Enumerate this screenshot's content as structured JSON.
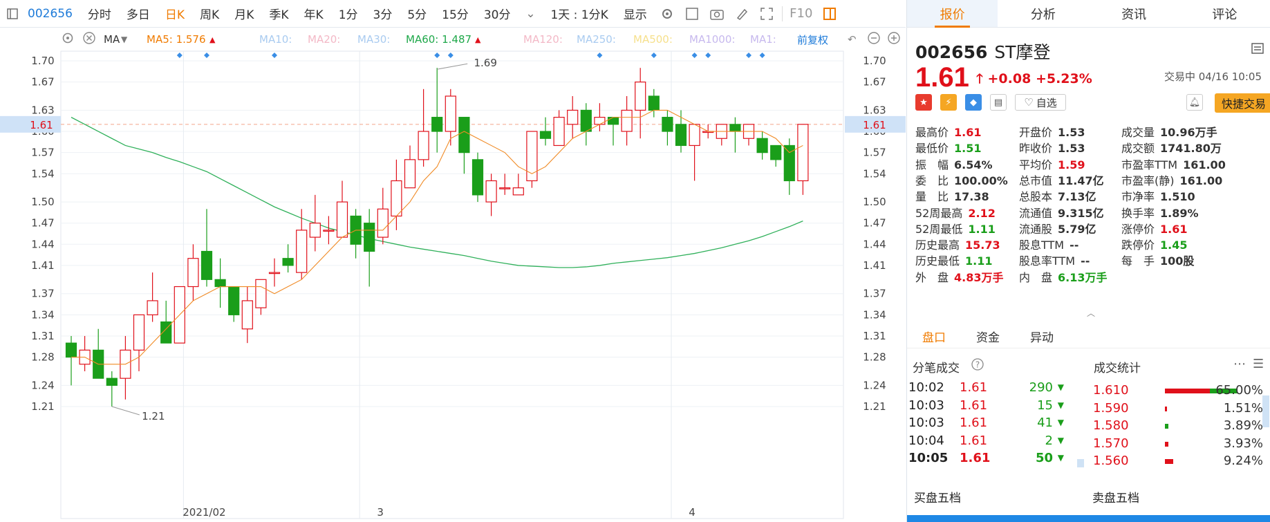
{
  "toolbar": {
    "code": "002656",
    "items": [
      "分时",
      "多日",
      "日K",
      "周K",
      "月K",
      "季K",
      "年K",
      "1分",
      "3分",
      "5分",
      "15分",
      "30分"
    ],
    "active_index": 2,
    "period_select": "1天 : 1分K",
    "display_label": "显示"
  },
  "ma_bar": {
    "ma_label": "MA",
    "ma5": "MA5: 1.576",
    "ma10": "MA10:",
    "ma20": "MA20:",
    "ma30": "MA30:",
    "ma60": "MA60: 1.487",
    "ma120": "MA120:",
    "ma250": "MA250:",
    "ma500": "MA500:",
    "ma1000": "MA1000:",
    "ma1": "MA1:",
    "adjust_label": "前复权",
    "colors": {
      "ma5": "#f07b00",
      "ma60": "#1fa84a",
      "faded_blue": "#a9cbf0",
      "faded_pink": "#f3b8c6",
      "faded_yellow": "#f6e08c",
      "faded_purple": "#c7b9ee"
    }
  },
  "chart_data": {
    "type": "candlestick",
    "y_ticks": [
      "1.70",
      "1.67",
      "1.63",
      "1.60",
      "1.57",
      "1.54",
      "1.50",
      "1.47",
      "1.44",
      "1.41",
      "1.37",
      "1.34",
      "1.31",
      "1.28",
      "1.24",
      "1.21"
    ],
    "ylim": [
      1.195,
      1.715
    ],
    "current_price": "1.61",
    "high_label": "1.69",
    "low_label": "1.21",
    "x_labels": [
      {
        "i": 9,
        "label": "2021/02"
      },
      {
        "i": 22,
        "label": "3"
      },
      {
        "i": 45,
        "label": "4"
      }
    ],
    "candles": [
      [
        1.3,
        1.28,
        1.31,
        1.24
      ],
      [
        1.27,
        1.29,
        1.31,
        1.26
      ],
      [
        1.29,
        1.25,
        1.32,
        1.25
      ],
      [
        1.25,
        1.24,
        1.26,
        1.21
      ],
      [
        1.25,
        1.29,
        1.31,
        1.22
      ],
      [
        1.29,
        1.34,
        1.34,
        1.26
      ],
      [
        1.34,
        1.36,
        1.4,
        1.33
      ],
      [
        1.33,
        1.3,
        1.36,
        1.3
      ],
      [
        1.3,
        1.38,
        1.38,
        1.3
      ],
      [
        1.38,
        1.42,
        1.44,
        1.36
      ],
      [
        1.43,
        1.39,
        1.49,
        1.38
      ],
      [
        1.39,
        1.38,
        1.42,
        1.35
      ],
      [
        1.38,
        1.34,
        1.38,
        1.33
      ],
      [
        1.32,
        1.36,
        1.38,
        1.3
      ],
      [
        1.35,
        1.39,
        1.39,
        1.34
      ],
      [
        1.4,
        1.4,
        1.42,
        1.38
      ],
      [
        1.42,
        1.41,
        1.44,
        1.4
      ],
      [
        1.4,
        1.46,
        1.49,
        1.39
      ],
      [
        1.45,
        1.47,
        1.51,
        1.43
      ],
      [
        1.46,
        1.46,
        1.48,
        1.44
      ],
      [
        1.45,
        1.5,
        1.53,
        1.45
      ],
      [
        1.48,
        1.44,
        1.49,
        1.42
      ],
      [
        1.47,
        1.43,
        1.49,
        1.38
      ],
      [
        1.45,
        1.49,
        1.52,
        1.44
      ],
      [
        1.48,
        1.53,
        1.56,
        1.46
      ],
      [
        1.52,
        1.56,
        1.58,
        1.52
      ],
      [
        1.56,
        1.6,
        1.66,
        1.55
      ],
      [
        1.62,
        1.6,
        1.69,
        1.57
      ],
      [
        1.6,
        1.65,
        1.66,
        1.58
      ],
      [
        1.62,
        1.57,
        1.62,
        1.54
      ],
      [
        1.56,
        1.51,
        1.57,
        1.5
      ],
      [
        1.5,
        1.53,
        1.54,
        1.48
      ],
      [
        1.52,
        1.52,
        1.54,
        1.51
      ],
      [
        1.51,
        1.52,
        1.54,
        1.51
      ],
      [
        1.53,
        1.6,
        1.6,
        1.52
      ],
      [
        1.6,
        1.59,
        1.62,
        1.58
      ],
      [
        1.58,
        1.62,
        1.63,
        1.58
      ],
      [
        1.61,
        1.63,
        1.65,
        1.59
      ],
      [
        1.63,
        1.6,
        1.64,
        1.58
      ],
      [
        1.61,
        1.62,
        1.64,
        1.6
      ],
      [
        1.62,
        1.61,
        1.62,
        1.58
      ],
      [
        1.6,
        1.63,
        1.65,
        1.58
      ],
      [
        1.63,
        1.67,
        1.69,
        1.59
      ],
      [
        1.65,
        1.63,
        1.66,
        1.62
      ],
      [
        1.62,
        1.6,
        1.63,
        1.58
      ],
      [
        1.61,
        1.58,
        1.63,
        1.57
      ],
      [
        1.58,
        1.61,
        1.61,
        1.53
      ],
      [
        1.6,
        1.6,
        1.61,
        1.59
      ],
      [
        1.59,
        1.61,
        1.61,
        1.58
      ],
      [
        1.61,
        1.6,
        1.62,
        1.57
      ],
      [
        1.59,
        1.61,
        1.61,
        1.58
      ],
      [
        1.59,
        1.57,
        1.6,
        1.56
      ],
      [
        1.58,
        1.56,
        1.58,
        1.55
      ],
      [
        1.58,
        1.53,
        1.59,
        1.51
      ],
      [
        1.53,
        1.61,
        1.61,
        1.51
      ]
    ],
    "ma5": [
      1.28,
      1.28,
      1.27,
      1.27,
      1.27,
      1.28,
      1.3,
      1.32,
      1.34,
      1.36,
      1.37,
      1.38,
      1.38,
      1.38,
      1.38,
      1.37,
      1.38,
      1.39,
      1.41,
      1.43,
      1.45,
      1.46,
      1.46,
      1.46,
      1.48,
      1.5,
      1.53,
      1.55,
      1.59,
      1.6,
      1.59,
      1.58,
      1.57,
      1.55,
      1.54,
      1.55,
      1.57,
      1.59,
      1.6,
      1.61,
      1.62,
      1.62,
      1.62,
      1.63,
      1.63,
      1.62,
      1.61,
      1.6,
      1.6,
      1.6,
      1.6,
      1.6,
      1.59,
      1.57,
      1.58
    ],
    "ma60": [
      1.62,
      1.61,
      1.6,
      1.59,
      1.58,
      1.575,
      1.57,
      1.563,
      1.557,
      1.55,
      1.543,
      1.533,
      1.523,
      1.513,
      1.503,
      1.493,
      1.485,
      1.477,
      1.47,
      1.463,
      1.458,
      1.453,
      1.448,
      1.444,
      1.44,
      1.436,
      1.433,
      1.43,
      1.427,
      1.424,
      1.42,
      1.416,
      1.413,
      1.41,
      1.409,
      1.408,
      1.407,
      1.407,
      1.408,
      1.41,
      1.413,
      1.415,
      1.417,
      1.419,
      1.421,
      1.424,
      1.427,
      1.431,
      1.435,
      1.44,
      1.445,
      1.451,
      1.458,
      1.465,
      1.473
    ]
  },
  "panel": {
    "tabs": [
      "报价",
      "分析",
      "资讯",
      "评论"
    ],
    "code": "002656",
    "name": "ST摩登",
    "price": "1.61",
    "change": "+0.08",
    "change_pct": "+5.23%",
    "trade_time": "交易中 04/16 10:05",
    "watch_label": "自选",
    "quick_trade_label": "快捷交易",
    "quotes": [
      {
        "label": "最高价",
        "value": "1.61",
        "cls": "up"
      },
      {
        "label": "开盘价",
        "value": "1.53",
        "cls": "nt"
      },
      {
        "label": "成交量",
        "value": "10.96万手",
        "cls": "nt"
      },
      {
        "label": "最低价",
        "value": "1.51",
        "cls": "dn"
      },
      {
        "label": "昨收价",
        "value": "1.53",
        "cls": "nt"
      },
      {
        "label": "成交额",
        "value": "1741.80万",
        "cls": "nt"
      },
      {
        "label": "振　幅",
        "value": "6.54%",
        "cls": "nt"
      },
      {
        "label": "平均价",
        "value": "1.59",
        "cls": "up"
      },
      {
        "label": "市盈率TTM",
        "value": "161.00",
        "cls": "nt"
      },
      {
        "label": "委　比",
        "value": "100.00%",
        "cls": "nt"
      },
      {
        "label": "总市值",
        "value": "11.47亿",
        "cls": "nt"
      },
      {
        "label": "市盈率(静)",
        "value": "161.00",
        "cls": "nt"
      },
      {
        "label": "量　比",
        "value": "17.38",
        "cls": "nt"
      },
      {
        "label": "总股本",
        "value": "7.13亿",
        "cls": "nt"
      },
      {
        "label": "市净率",
        "value": "1.510",
        "cls": "nt"
      },
      {
        "label": "52周最高",
        "value": "2.12",
        "cls": "up"
      },
      {
        "label": "流通值",
        "value": "9.315亿",
        "cls": "nt"
      },
      {
        "label": "换手率",
        "value": "1.89%",
        "cls": "nt"
      },
      {
        "label": "52周最低",
        "value": "1.11",
        "cls": "dn"
      },
      {
        "label": "流通股",
        "value": "5.79亿",
        "cls": "nt"
      },
      {
        "label": "涨停价",
        "value": "1.61",
        "cls": "up"
      },
      {
        "label": "历史最高",
        "value": "15.73",
        "cls": "up"
      },
      {
        "label": "股息TTM",
        "value": "--",
        "cls": "nt"
      },
      {
        "label": "跌停价",
        "value": "1.45",
        "cls": "dn"
      },
      {
        "label": "历史最低",
        "value": "1.11",
        "cls": "dn"
      },
      {
        "label": "股息率TTM",
        "value": "--",
        "cls": "nt"
      },
      {
        "label": "每　手",
        "value": "100股",
        "cls": "nt"
      },
      {
        "label": "外　盘",
        "value": "4.83万手",
        "cls": "up"
      },
      {
        "label": "内　盘",
        "value": "6.13万手",
        "cls": "dn"
      }
    ],
    "subtabs": [
      "盘口",
      "资金",
      "异动"
    ],
    "ticks_title": "分笔成交",
    "stats_title": "成交统计",
    "ticks": [
      {
        "time": "10:02",
        "price": "1.61",
        "vol": "290"
      },
      {
        "time": "10:03",
        "price": "1.61",
        "vol": "15"
      },
      {
        "time": "10:03",
        "price": "1.61",
        "vol": "41"
      },
      {
        "time": "10:04",
        "price": "1.61",
        "vol": "2"
      },
      {
        "time": "10:05",
        "price": "1.61",
        "vol": "50"
      }
    ],
    "stats": [
      {
        "price": "1.610",
        "pct": "65.00%",
        "ratio": 0.65
      },
      {
        "price": "1.590",
        "pct": "1.51%",
        "ratio": 0.0151
      },
      {
        "price": "1.580",
        "pct": "3.89%",
        "ratio": 0.0389
      },
      {
        "price": "1.570",
        "pct": "3.93%",
        "ratio": 0.0393
      },
      {
        "price": "1.560",
        "pct": "9.24%",
        "ratio": 0.0924
      }
    ],
    "buy_five": "买盘五档",
    "sell_five": "卖盘五档"
  }
}
